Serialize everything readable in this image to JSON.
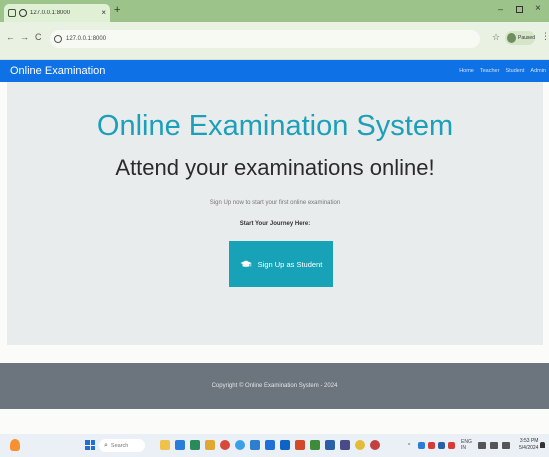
{
  "browser": {
    "tab_title": "127.0.0.1:8000",
    "new_tab_glyph": "+",
    "tab_close_glyph": "×",
    "url": "127.0.0.1:8000",
    "profile_label": "Paused",
    "nav": {
      "back": "←",
      "forward": "→",
      "reload": "C"
    },
    "window": {
      "minimize": "–",
      "close": "×"
    },
    "star_glyph": "☆",
    "menu_glyph": "⋮"
  },
  "site": {
    "brand": "Online Examination",
    "nav_links": [
      "Home",
      "Teacher",
      "Student",
      "Admin"
    ],
    "accent_color": "#0e72e6",
    "primary_teal": "#17a2b8"
  },
  "hero": {
    "title": "Online Examination System",
    "subtitle": "Attend your examinations online!",
    "tagline": "Sign Up now to start your first online examination",
    "journey_label": "Start Your Journey Here:",
    "signup_button": "Sign Up as Student",
    "signup_icon": "graduation-cap-icon"
  },
  "footer": {
    "copyright": "Copyright © Online Examination System - 2024"
  },
  "taskbar": {
    "search_label": "Search",
    "search_glyph": "⌕",
    "time": "3:53 PM",
    "date": "5/4/2024",
    "tray_lang": "ENG",
    "tray_region": "IN"
  }
}
